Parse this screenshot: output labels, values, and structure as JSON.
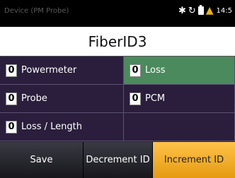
{
  "status": {
    "left_text": "Device (PM Probe)",
    "time": "14:5",
    "icons": [
      "bluetooth-icon",
      "refresh-icon",
      "battery-icon",
      "warning-icon"
    ]
  },
  "title": "FiberID3",
  "counters": {
    "powermeter": {
      "count": "0",
      "label": "Powermeter"
    },
    "loss": {
      "count": "0",
      "label": "Loss"
    },
    "probe": {
      "count": "0",
      "label": "Probe"
    },
    "pcm": {
      "count": "0",
      "label": "PCM"
    },
    "loss_length": {
      "count": "0",
      "label": "Loss / Length"
    }
  },
  "softkeys": {
    "save": "Save",
    "decrement": "Decrement ID",
    "increment": "Increment ID"
  },
  "colors": {
    "selected_cell": "#4a8a5c",
    "grid_bg": "#2a1e3c",
    "accent_softkey": "#f2ad2a"
  }
}
